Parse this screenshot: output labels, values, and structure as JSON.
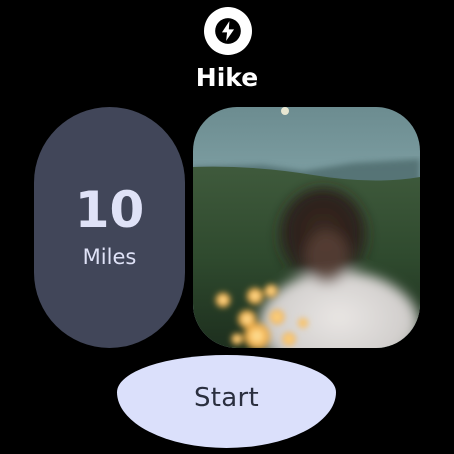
{
  "app": {
    "icon": "lightning-bolt-icon",
    "title": "Hike"
  },
  "stat": {
    "value": "10",
    "unit": "Miles"
  },
  "photo": {
    "subject": "person-in-field-at-dusk-image"
  },
  "action": {
    "start_label": "Start"
  },
  "colors": {
    "background": "#000000",
    "chip": "#414659",
    "chip_text": "#dfe2f7",
    "button": "#dbe0fb",
    "button_text": "#2a2f3f"
  }
}
